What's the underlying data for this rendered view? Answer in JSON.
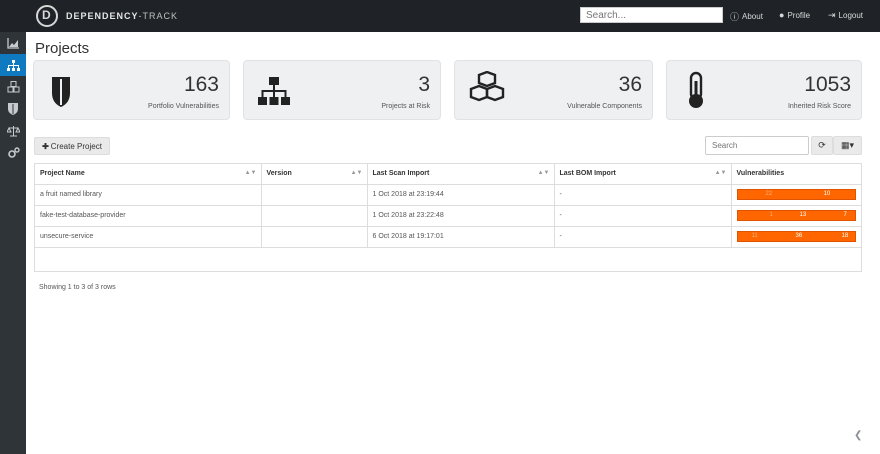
{
  "app": {
    "brand_bold": "DEPENDENCY",
    "brand_light": "-TRACK"
  },
  "topbar": {
    "search_placeholder": "Search...",
    "links": [
      {
        "icon": "info-icon",
        "label": "About"
      },
      {
        "icon": "user-icon",
        "label": "Profile"
      },
      {
        "icon": "logout-icon",
        "label": "Logout"
      }
    ]
  },
  "sidebar": {
    "items": [
      {
        "icon": "dashboard-icon",
        "active": false
      },
      {
        "icon": "projects-icon",
        "active": true
      },
      {
        "icon": "components-icon",
        "active": false
      },
      {
        "icon": "vulnerabilities-icon",
        "active": false
      },
      {
        "icon": "licenses-icon",
        "active": false
      },
      {
        "icon": "admin-icon",
        "active": false
      }
    ]
  },
  "page": {
    "title": "Projects"
  },
  "cards": [
    {
      "icon": "shield-icon",
      "value": "163",
      "label": "Portfolio Vulnerabilities"
    },
    {
      "icon": "sitemap-icon",
      "value": "3",
      "label": "Projects at Risk"
    },
    {
      "icon": "cubes-icon",
      "value": "36",
      "label": "Vulnerable Components"
    },
    {
      "icon": "thermometer-icon",
      "value": "1053",
      "label": "Inherited Risk Score"
    }
  ],
  "toolbar": {
    "create_label": "Create Project",
    "search_placeholder": "Search",
    "refresh_icon": "refresh-icon",
    "columns_icon": "columns-icon"
  },
  "table": {
    "headers": [
      "Project Name",
      "Version",
      "Last Scan Import",
      "Last BOM Import",
      "Vulnerabilities"
    ],
    "rows": [
      {
        "name": "a fruit named library",
        "version": "",
        "last_scan": "1 Oct 2018 at 23:19:44",
        "last_bom": "-",
        "vulns": {
          "a": "22",
          "b": "10",
          "color": "#ff6600"
        }
      },
      {
        "name": "fake-test-database-provider",
        "version": "",
        "last_scan": "1 Oct 2018 at 23:22:48",
        "last_bom": "-",
        "vulns": {
          "a": "1",
          "b": "13",
          "c": "7",
          "color": "#ff6600"
        }
      },
      {
        "name": "unsecure-service",
        "version": "",
        "last_scan": "6 Oct 2018 at 19:17:01",
        "last_bom": "-",
        "vulns": {
          "a": "11",
          "b": "36",
          "c": "18",
          "color": "#ff6600"
        }
      }
    ]
  },
  "footer": {
    "rows_text": "Showing 1 to 3 of 3 rows"
  },
  "colors": {
    "topbar": "#1f2327",
    "sidebar": "#2f3439",
    "accent": "#0f7ac0",
    "vuln_bar": "#ff6600"
  }
}
